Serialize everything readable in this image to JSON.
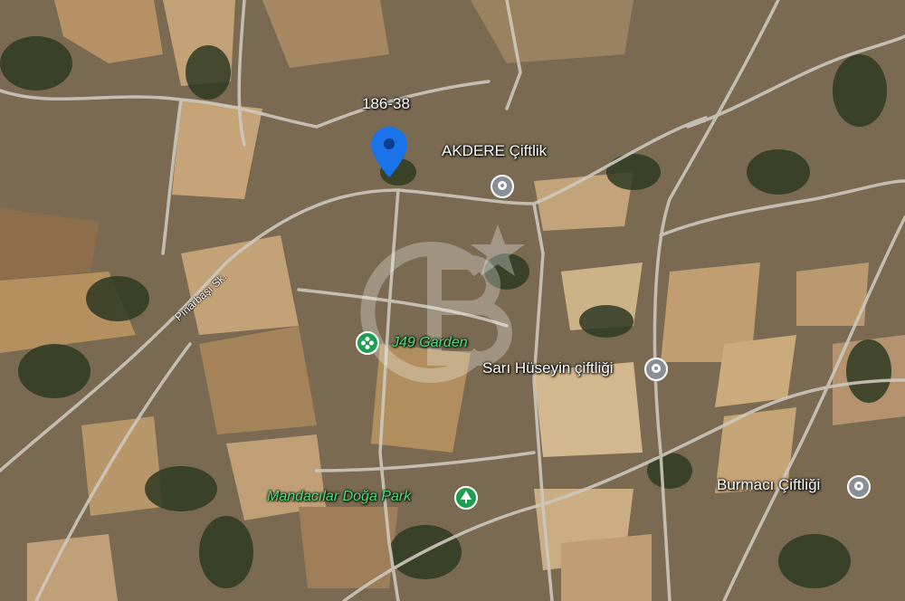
{
  "pin": {
    "label": "186-38",
    "color": "#1a73e8"
  },
  "places": [
    {
      "id": "akdere",
      "name": "AKDERE Çiftlik",
      "type": "gray"
    },
    {
      "id": "j49",
      "name": "J49 Garden",
      "type": "green"
    },
    {
      "id": "sari",
      "name": "Sarı Hüseyin çiftliği",
      "type": "gray"
    },
    {
      "id": "mandacilar",
      "name": "Mandacılar Doğa Park",
      "type": "green"
    },
    {
      "id": "burmaci",
      "name": "Burmacı Çiftliği",
      "type": "gray"
    }
  ],
  "roads": {
    "pinarbasi": "Pınarbaşı Sk."
  },
  "colors": {
    "terrain": "#7a6a52",
    "road": "#c9c4b8",
    "field_light": "#c9a57a",
    "field_dark": "#5f5030",
    "vegetation": "#2f3a22"
  },
  "icons": {
    "poi_pin": "location-pin-icon",
    "poi_tree": "tree-icon",
    "poi_flower": "flower-icon"
  }
}
